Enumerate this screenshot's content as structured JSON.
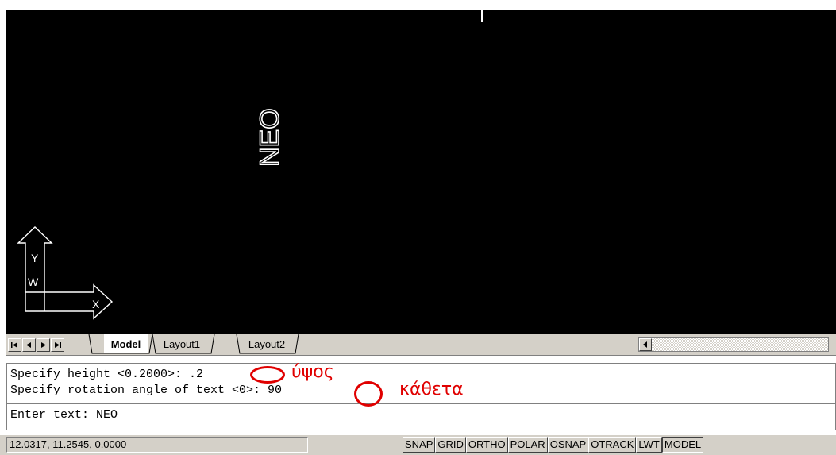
{
  "canvas": {
    "drawn_text": "NEO",
    "ucs": {
      "y_label": "Y",
      "w_label": "W",
      "x_label": "X"
    }
  },
  "layout_tabs": {
    "nav_buttons": [
      "first",
      "previous",
      "next",
      "last"
    ],
    "tabs": [
      {
        "label": "Model",
        "active": true
      },
      {
        "label": "Layout1",
        "active": false
      },
      {
        "label": "Layout2",
        "active": false
      }
    ]
  },
  "command_window": {
    "history": [
      "Specify height <0.2000>: .2",
      "Specify rotation angle of text <0>: 90"
    ],
    "prompt": "Enter text: NEO",
    "annotations": {
      "height_note": "ύψος",
      "angle_note": "κάθετα",
      "color": "#e00000"
    }
  },
  "status_bar": {
    "coordinates": "12.0317, 11.2545, 0.0000",
    "toggles": [
      "SNAP",
      "GRID",
      "ORTHO",
      "POLAR",
      "OSNAP",
      "OTRACK",
      "LWT",
      "MODEL"
    ],
    "active_toggle": "MODEL"
  },
  "colors": {
    "canvas_bg": "#000000",
    "ui_face": "#d4d0c8"
  }
}
